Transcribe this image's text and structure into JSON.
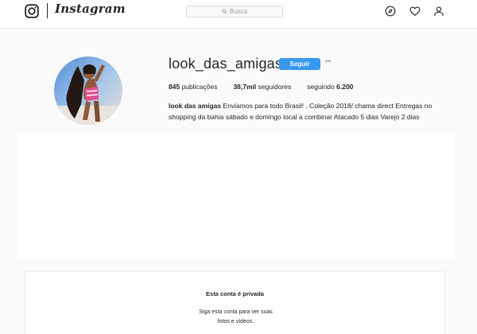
{
  "header": {
    "brand": "Instagram",
    "logo_icon": "instagram-camera-icon",
    "search_icon": "search-icon",
    "search_placeholder": "Busca",
    "nav_icons": [
      "compass-icon",
      "heart-icon",
      "user-icon"
    ]
  },
  "profile": {
    "username": "look_das_amigas",
    "follow_label": "Seguir",
    "more_label": "···",
    "stats": {
      "posts_count": "845",
      "posts_label": "publicações",
      "followers_count": "38,7mil",
      "followers_label": "seguidores",
      "following_label": "seguindo",
      "following_count": "6.200"
    },
    "bio_name": "look das amigas",
    "bio_text": "Enviamos para todo Brasil! . Coleção 2018/ chama direct Entregas no shopping da bahia sábado e domingo local a combinar Atacado 5 dias Varejo 2 dias"
  },
  "private": {
    "title": "Esta conta é privada",
    "description": "Siga esta conta para ver suas fotos e vídeos."
  },
  "colors": {
    "accent": "#3897f0",
    "background": "#fafafa",
    "text": "#262626",
    "border": "#e6e6e6"
  }
}
